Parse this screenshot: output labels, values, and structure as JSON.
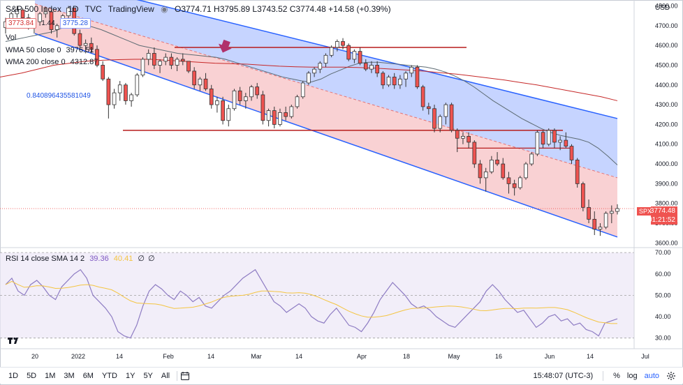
{
  "symbol": {
    "name": "S&P 500 Index",
    "interval": "1D",
    "source": "TVC",
    "platform": "TradingView",
    "ohlc": "O3774.71 H3795.89 L3743.52 C3774.48 +14.58 (+0.39%)",
    "bid": "3773.84",
    "spread": "1.44",
    "ask": "3775.28"
  },
  "indicators": {
    "vol_label": "Vol",
    "wma50_label": "WMA 50 close 0",
    "wma50_value": "3976.51",
    "wma200_label": "WMA 200 close 0",
    "wma200_value": "4312.87",
    "fib_value": "0.840896435581049",
    "rsi_label": "RSI 14 close SMA 14 2",
    "rsi_value": "39.36",
    "rsi_sma_value": "40.41",
    "rsi_extra1": "∅",
    "rsi_extra2": "∅"
  },
  "axis": {
    "currency": "USD",
    "price_ticks": [
      "4800.00",
      "4700.00",
      "4600.00",
      "4500.00",
      "4400.00",
      "4300.00",
      "4200.00",
      "4100.00",
      "4000.00",
      "3900.00",
      "3800.00",
      "3700.00",
      "3600.00"
    ],
    "rsi_ticks": [
      "70.00",
      "60.00",
      "50.00",
      "40.00",
      "30.00"
    ],
    "time_ticks": [
      "20",
      "2022",
      "14",
      "Feb",
      "14",
      "Mar",
      "14",
      "Apr",
      "18",
      "May",
      "16",
      "Jun",
      "14",
      "Jul"
    ]
  },
  "last_price": {
    "tag": "SPX",
    "value": "3774.48",
    "countdown": "01:21:52"
  },
  "bottom": {
    "timeframes": [
      "1D",
      "5D",
      "1M",
      "3M",
      "6M",
      "YTD",
      "1Y",
      "5Y",
      "All"
    ],
    "clock": "15:48:07 (UTC-3)",
    "percent": "%",
    "log": "log",
    "auto": "auto"
  },
  "colors": {
    "up": "#26a69a",
    "down": "#ef5350",
    "channel_upper": "#b3c6ff",
    "channel_lower": "#f8c5c8",
    "channel_line": "#2962ff",
    "hline": "#b71c1c",
    "wma50": "#5d6b73",
    "wma200": "#c62828",
    "rsi": "#8e7cc3",
    "rsi_sma": "#f4c542",
    "arrow": "#b0306b"
  },
  "chart_data": {
    "type": "candlestick",
    "title": "S&P 500 Index, 1D",
    "price_range": [
      3580,
      4830
    ],
    "rsi_range": [
      25,
      72
    ],
    "candles": [
      [
        4690,
        4740,
        4660,
        4720
      ],
      [
        4720,
        4770,
        4700,
        4760
      ],
      [
        4760,
        4800,
        4740,
        4780
      ],
      [
        4780,
        4790,
        4720,
        4740
      ],
      [
        4740,
        4760,
        4680,
        4700
      ],
      [
        4700,
        4730,
        4660,
        4720
      ],
      [
        4720,
        4770,
        4700,
        4760
      ],
      [
        4760,
        4796,
        4740,
        4770
      ],
      [
        4770,
        4780,
        4660,
        4680
      ],
      [
        4680,
        4710,
        4640,
        4700
      ],
      [
        4700,
        4760,
        4690,
        4750
      ],
      [
        4750,
        4800,
        4730,
        4790
      ],
      [
        4790,
        4790,
        4650,
        4660
      ],
      [
        4660,
        4680,
        4580,
        4600
      ],
      [
        4600,
        4630,
        4560,
        4610
      ],
      [
        4610,
        4640,
        4560,
        4580
      ],
      [
        4580,
        4600,
        4490,
        4500
      ],
      [
        4500,
        4520,
        4420,
        4430
      ],
      [
        4430,
        4440,
        4230,
        4300
      ],
      [
        4300,
        4380,
        4280,
        4360
      ],
      [
        4360,
        4420,
        4320,
        4400
      ],
      [
        4400,
        4410,
        4300,
        4320
      ],
      [
        4320,
        4360,
        4290,
        4350
      ],
      [
        4350,
        4460,
        4340,
        4450
      ],
      [
        4450,
        4540,
        4440,
        4530
      ],
      [
        4530,
        4580,
        4500,
        4560
      ],
      [
        4560,
        4590,
        4480,
        4500
      ],
      [
        4500,
        4530,
        4460,
        4520
      ],
      [
        4520,
        4560,
        4500,
        4540
      ],
      [
        4540,
        4560,
        4480,
        4500
      ],
      [
        4500,
        4540,
        4470,
        4530
      ],
      [
        4530,
        4560,
        4500,
        4520
      ],
      [
        4520,
        4520,
        4460,
        4470
      ],
      [
        4470,
        4490,
        4380,
        4400
      ],
      [
        4400,
        4440,
        4370,
        4430
      ],
      [
        4430,
        4460,
        4370,
        4380
      ],
      [
        4380,
        4400,
        4280,
        4300
      ],
      [
        4300,
        4340,
        4260,
        4320
      ],
      [
        4320,
        4340,
        4200,
        4220
      ],
      [
        4220,
        4300,
        4190,
        4280
      ],
      [
        4280,
        4380,
        4270,
        4370
      ],
      [
        4370,
        4390,
        4300,
        4320
      ],
      [
        4320,
        4360,
        4280,
        4340
      ],
      [
        4340,
        4400,
        4320,
        4390
      ],
      [
        4390,
        4410,
        4330,
        4350
      ],
      [
        4350,
        4370,
        4200,
        4220
      ],
      [
        4220,
        4280,
        4190,
        4270
      ],
      [
        4270,
        4290,
        4180,
        4200
      ],
      [
        4200,
        4280,
        4190,
        4260
      ],
      [
        4260,
        4290,
        4220,
        4240
      ],
      [
        4240,
        4300,
        4230,
        4290
      ],
      [
        4290,
        4350,
        4280,
        4340
      ],
      [
        4340,
        4420,
        4330,
        4410
      ],
      [
        4410,
        4470,
        4400,
        4460
      ],
      [
        4460,
        4490,
        4440,
        4480
      ],
      [
        4480,
        4520,
        4460,
        4510
      ],
      [
        4510,
        4560,
        4490,
        4550
      ],
      [
        4550,
        4600,
        4540,
        4590
      ],
      [
        4590,
        4630,
        4570,
        4620
      ],
      [
        4620,
        4637,
        4580,
        4600
      ],
      [
        4600,
        4610,
        4520,
        4530
      ],
      [
        4530,
        4580,
        4510,
        4570
      ],
      [
        4570,
        4590,
        4500,
        4510
      ],
      [
        4510,
        4530,
        4470,
        4480
      ],
      [
        4480,
        4520,
        4460,
        4500
      ],
      [
        4500,
        4520,
        4440,
        4460
      ],
      [
        4460,
        4470,
        4380,
        4400
      ],
      [
        4400,
        4450,
        4390,
        4440
      ],
      [
        4440,
        4460,
        4380,
        4400
      ],
      [
        4400,
        4450,
        4380,
        4430
      ],
      [
        4430,
        4470,
        4390,
        4460
      ],
      [
        4460,
        4500,
        4440,
        4490
      ],
      [
        4490,
        4500,
        4380,
        4390
      ],
      [
        4390,
        4400,
        4270,
        4290
      ],
      [
        4290,
        4310,
        4250,
        4280
      ],
      [
        4280,
        4300,
        4160,
        4180
      ],
      [
        4180,
        4250,
        4160,
        4240
      ],
      [
        4240,
        4310,
        4200,
        4300
      ],
      [
        4300,
        4310,
        4160,
        4170
      ],
      [
        4170,
        4180,
        4060,
        4130
      ],
      [
        4130,
        4160,
        4100,
        4140
      ],
      [
        4140,
        4160,
        4080,
        4110
      ],
      [
        4110,
        4120,
        3980,
        4000
      ],
      [
        4000,
        4020,
        3900,
        3930
      ],
      [
        3930,
        3980,
        3860,
        3960
      ],
      [
        3960,
        4040,
        3950,
        4020
      ],
      [
        4020,
        4060,
        3990,
        4000
      ],
      [
        4000,
        4030,
        3920,
        3930
      ],
      [
        3930,
        3960,
        3850,
        3900
      ],
      [
        3900,
        3920,
        3840,
        3880
      ],
      [
        3880,
        3940,
        3870,
        3930
      ],
      [
        3930,
        4010,
        3920,
        4000
      ],
      [
        4000,
        4060,
        3990,
        4050
      ],
      [
        4050,
        4170,
        4040,
        4160
      ],
      [
        4160,
        4170,
        4080,
        4100
      ],
      [
        4100,
        4180,
        4090,
        4170
      ],
      [
        4170,
        4180,
        4080,
        4110
      ],
      [
        4110,
        4140,
        4070,
        4120
      ],
      [
        4120,
        4160,
        4080,
        4090
      ],
      [
        4090,
        4100,
        4000,
        4020
      ],
      [
        4020,
        4030,
        3880,
        3900
      ],
      [
        3900,
        3910,
        3760,
        3780
      ],
      [
        3780,
        3820,
        3700,
        3720
      ],
      [
        3720,
        3760,
        3640,
        3670
      ],
      [
        3670,
        3700,
        3636,
        3680
      ],
      [
        3680,
        3760,
        3670,
        3750
      ],
      [
        3750,
        3790,
        3700,
        3760
      ],
      [
        3760,
        3796,
        3744,
        3774
      ]
    ],
    "wma50": [
      4620,
      4630,
      4640,
      4650,
      4660,
      4670,
      4690,
      4700,
      4700,
      4695,
      4680,
      4660,
      4640,
      4620,
      4600,
      4590,
      4580,
      4570,
      4560,
      4555,
      4550,
      4545,
      4540,
      4530,
      4515,
      4500,
      4485,
      4470,
      4455,
      4440,
      4430,
      4420,
      4415,
      4430,
      4455,
      4475,
      4495,
      4510,
      4515,
      4515,
      4510,
      4505,
      4500,
      4495,
      4490,
      4480,
      4465,
      4445,
      4420,
      4390,
      4355,
      4320,
      4290,
      4260,
      4230,
      4205,
      4180,
      4160,
      4145,
      4135,
      4125,
      4110,
      4080,
      4040,
      3995
    ],
    "wma200": [
      4440,
      4460,
      4480,
      4500,
      4510,
      4520,
      4525,
      4528,
      4530,
      4530,
      4525,
      4520,
      4515,
      4510,
      4508,
      4505,
      4500,
      4495,
      4492,
      4490,
      4490,
      4490,
      4488,
      4485,
      4480,
      4475,
      4470,
      4462,
      4455,
      4445,
      4435,
      4425,
      4412,
      4400,
      4385,
      4370,
      4355,
      4340,
      4320
    ],
    "rsi": [
      55,
      58,
      52,
      50,
      55,
      57,
      54,
      50,
      48,
      54,
      57,
      60,
      62,
      58,
      50,
      47,
      44,
      40,
      33,
      31,
      30,
      36,
      45,
      52,
      55,
      53,
      50,
      48,
      52,
      50,
      47,
      49,
      45,
      44,
      47,
      50,
      52,
      55,
      58,
      60,
      62,
      57,
      52,
      47,
      45,
      42,
      44,
      46,
      44,
      40,
      38,
      37,
      41,
      44,
      40,
      36,
      35,
      33,
      37,
      42,
      48,
      52,
      56,
      53,
      50,
      46,
      44,
      45,
      43,
      40,
      38,
      36,
      35,
      38,
      41,
      44,
      47,
      52,
      55,
      52,
      48,
      45,
      42,
      43,
      39,
      35,
      37,
      40,
      41,
      38,
      39,
      36,
      37,
      34,
      33,
      31,
      37,
      38,
      39
    ]
  }
}
